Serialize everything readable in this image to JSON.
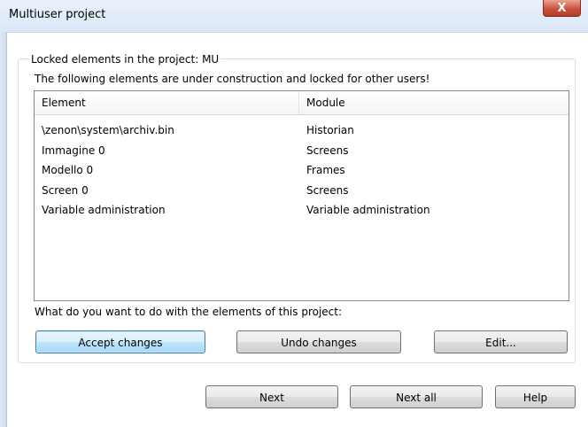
{
  "window": {
    "title": "Multiuser project",
    "close_glyph": "X"
  },
  "group": {
    "caption": "Locked elements in the project: MU",
    "info": "The following elements are under construction and locked for other users!"
  },
  "list": {
    "columns": [
      "Element",
      "Module"
    ],
    "rows": [
      [
        "\\zenon\\system\\archiv.bin",
        "Historian"
      ],
      [
        "Immagine 0",
        "Screens"
      ],
      [
        "Modello 0",
        "Frames"
      ],
      [
        "Screen 0",
        "Screens"
      ],
      [
        "Variable administration",
        "Variable administration"
      ]
    ]
  },
  "question": "What do you want to do with the elements of this project:",
  "actions": {
    "accept": "Accept changes",
    "undo": "Undo changes",
    "edit": "Edit..."
  },
  "footer": {
    "next": "Next",
    "next_all": "Next all",
    "help": "Help"
  }
}
